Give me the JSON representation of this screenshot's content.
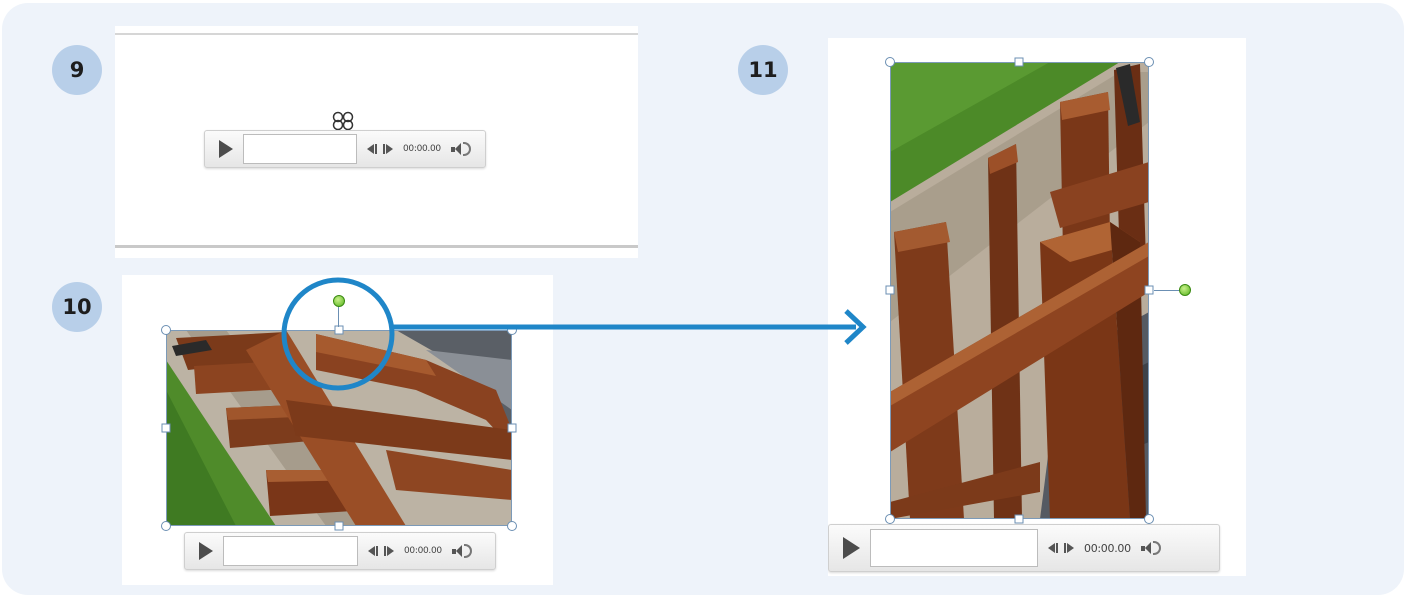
{
  "steps": {
    "step9": "9",
    "step10": "10",
    "step11": "11"
  },
  "media_controls": {
    "time": "00:00.00"
  },
  "colors": {
    "card_background": "#eef3fa",
    "badge": "#b8cfe9",
    "arrow": "#1f86c8",
    "highlight_circle": "#1f86c8",
    "rotation_handle": "#56b31c"
  },
  "icons": {
    "play": "play-icon",
    "previous": "step-back-icon",
    "next": "step-forward-icon",
    "volume": "volume-icon",
    "move": "move-cursor-icon",
    "arrow": "right-arrow-icon"
  }
}
